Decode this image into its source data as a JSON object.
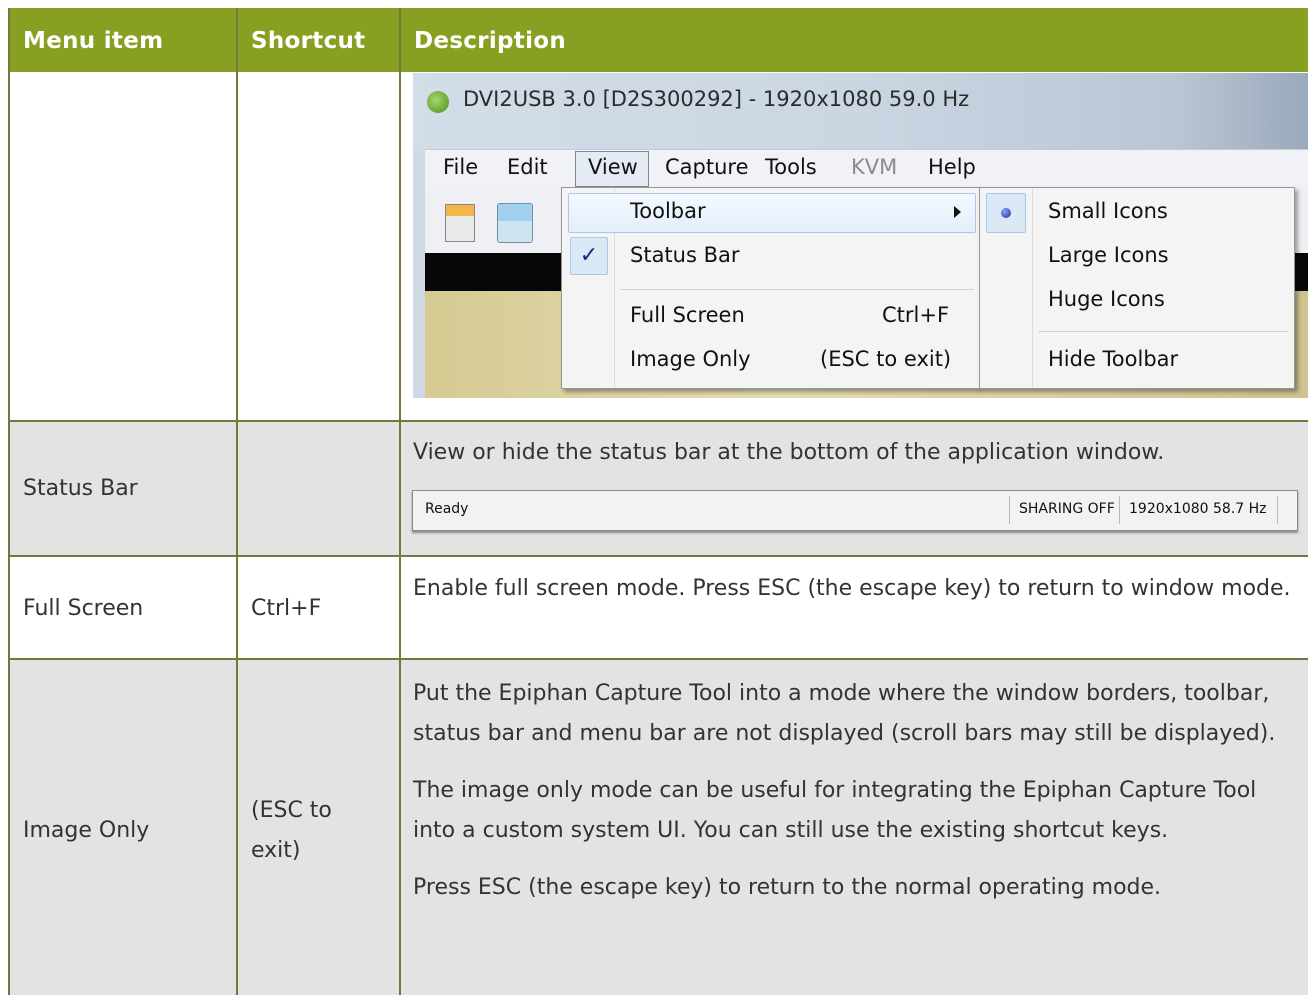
{
  "table": {
    "headers": [
      "Menu item",
      "Shortcut",
      "Description"
    ],
    "rows": [
      {
        "item": "",
        "shortcut": "",
        "description": []
      },
      {
        "item": "Status Bar",
        "shortcut": "",
        "description": [
          "View or hide the status bar at the bottom of the application window."
        ]
      },
      {
        "item": "Full Screen",
        "shortcut": "Ctrl+F",
        "description": [
          "Enable full screen mode. Press ESC (the escape key) to return to window mode."
        ]
      },
      {
        "item": "Image Only",
        "shortcut": "(ESC to exit)",
        "description": [
          "Put the Epiphan Capture Tool into a mode where the window borders, toolbar, status bar and menu bar are not displayed (scroll bars may still be displayed).",
          "The image only mode can be useful for integrating the Epiphan Capture Tool into a custom system UI. You can still use the existing shortcut keys.",
          "Press ESC (the escape key) to return to the normal operating mode."
        ]
      }
    ]
  },
  "screenshot": {
    "window_title": "DVI2USB 3.0 [D2S300292]  - 1920x1080 59.0 Hz",
    "menus": [
      "File",
      "Edit",
      "View",
      "Capture",
      "Tools",
      "KVM",
      "Help"
    ],
    "view_menu": {
      "toolbar": "Toolbar",
      "status_bar": "Status Bar",
      "check": "✓",
      "full_screen": "Full Screen",
      "full_screen_shortcut": "Ctrl+F",
      "image_only": "Image Only",
      "image_only_shortcut": "(ESC to exit)"
    },
    "toolbar_submenu": {
      "small": "Small Icons",
      "large": "Large Icons",
      "huge": "Huge Icons",
      "hide": "Hide Toolbar"
    }
  },
  "status_bar_image": {
    "ready": "Ready",
    "sharing": "SHARING OFF",
    "signal": "1920x1080 58.7 Hz"
  }
}
